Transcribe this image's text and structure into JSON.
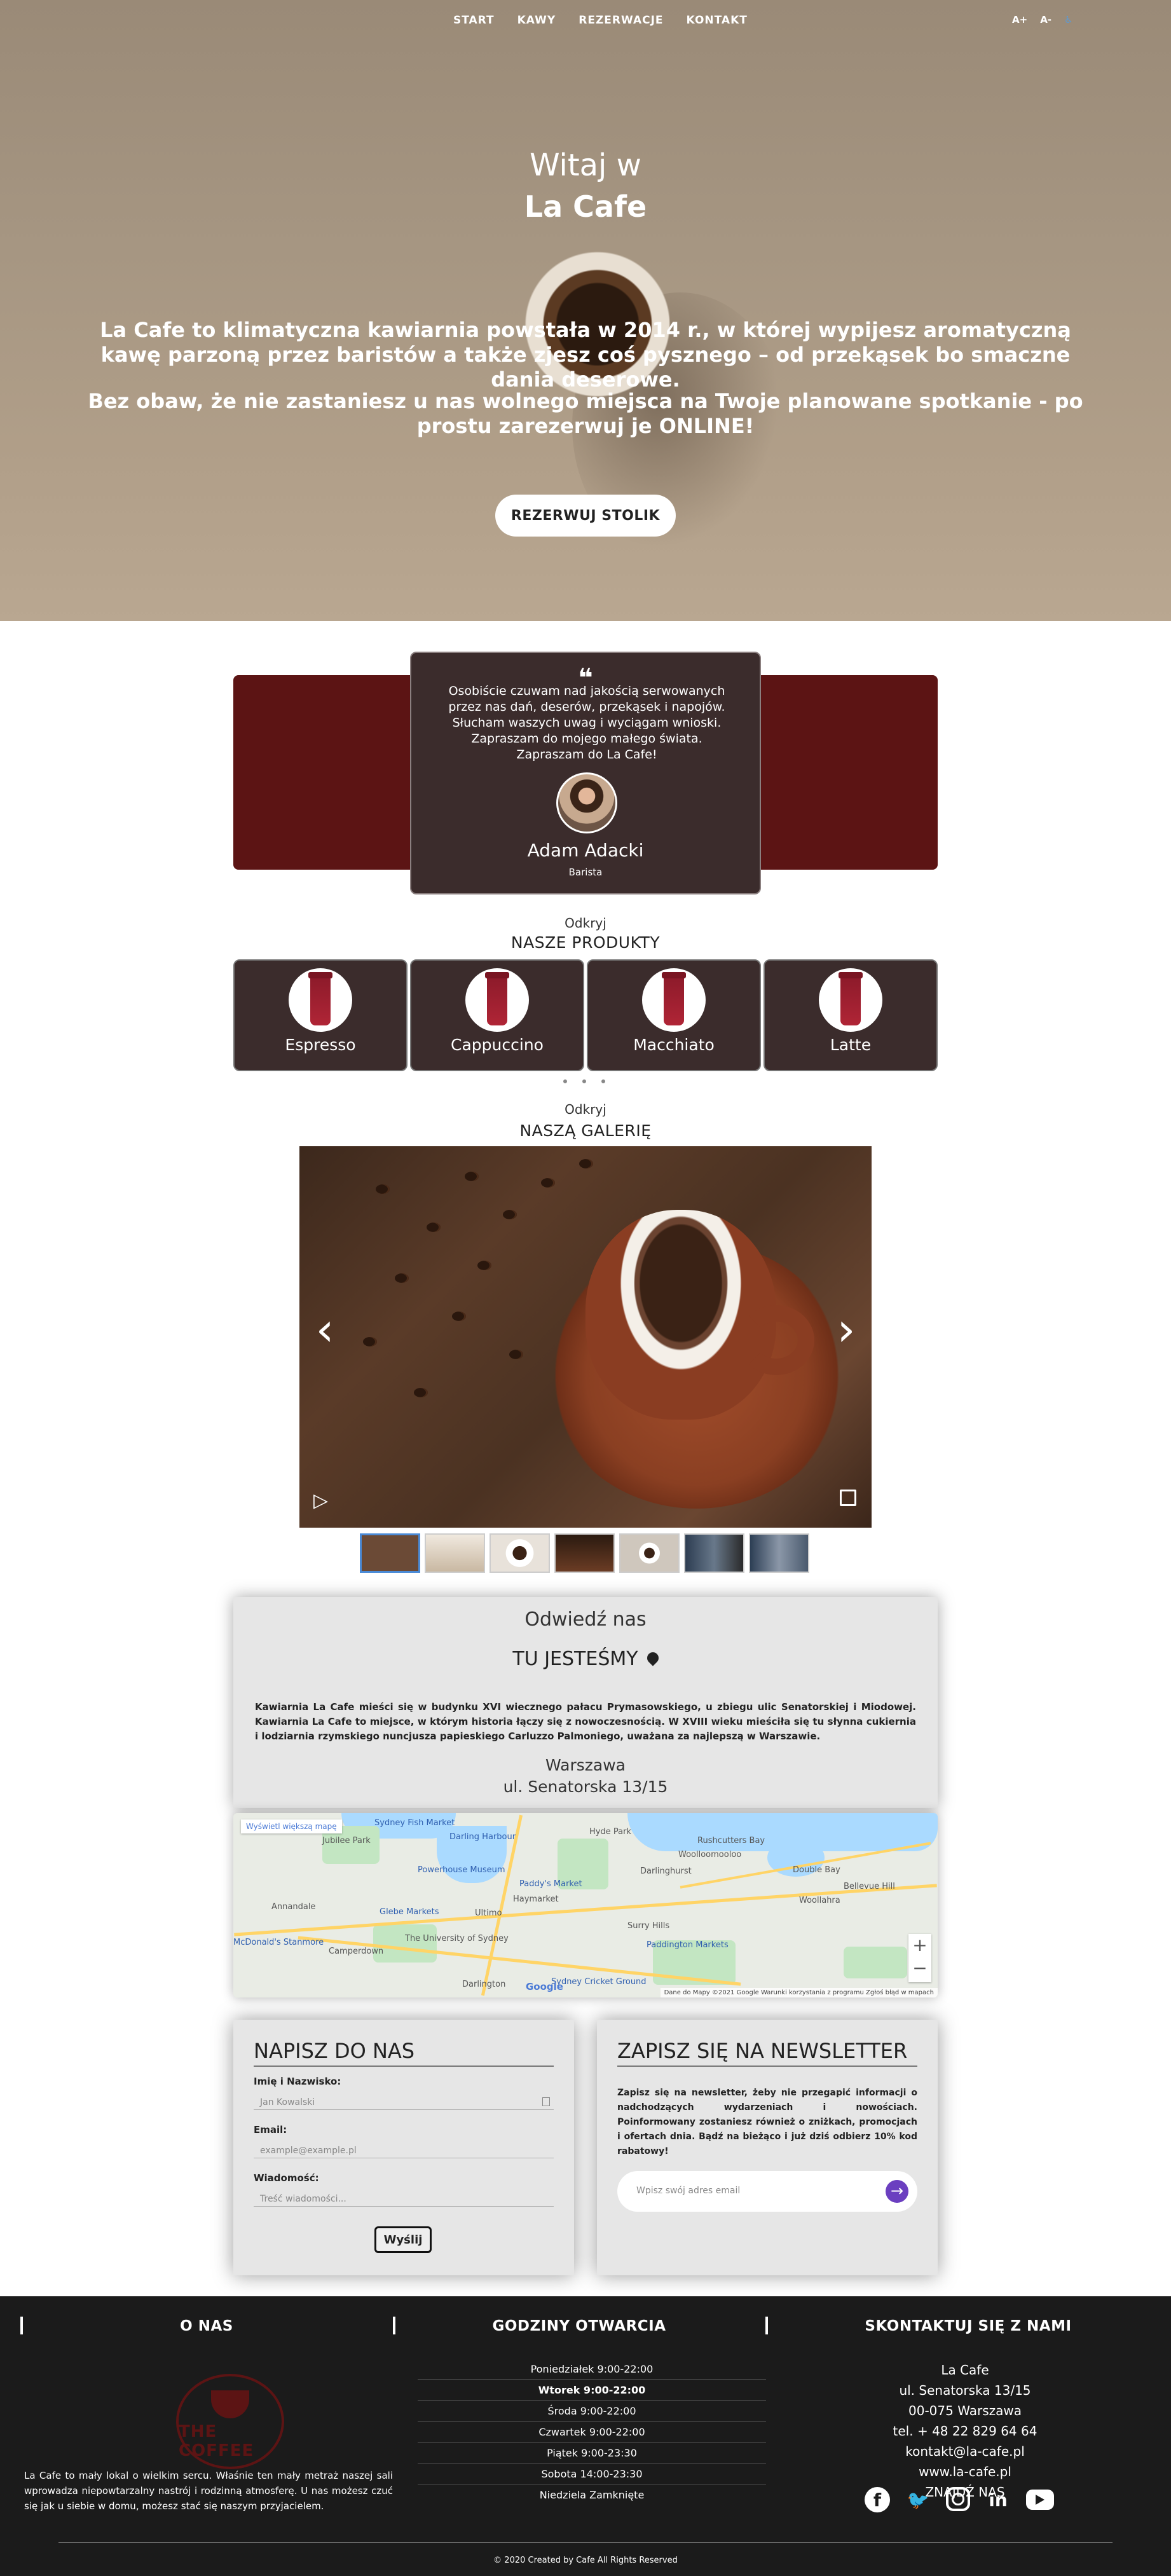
{
  "nav": {
    "links": [
      "START",
      "KAWY",
      "REZERWACJE",
      "KONTAKT"
    ],
    "font_bigger": "A+",
    "font_smaller": "A-"
  },
  "hero": {
    "title_line1": "Witaj w",
    "title_line2": "La Cafe",
    "paragraph1": "La Cafe to klimatyczna kawiarnia powstała w 2014 r., w której wypijesz aromatyczną kawę parzoną przez baristów a także zjesz coś pysznego – od przekąsek bo smaczne dania deserowe.",
    "paragraph2": "Bez obaw, że nie zastaniesz u nas wolnego miejsca na Twoje planowane spotkanie - po prostu zarezerwuj je ONLINE!",
    "cta": "REZERWUJ STOLIK"
  },
  "testimonial": {
    "quote_mark": "❝",
    "text": "Osobiście czuwam nad jakością serwowanych przez nas dań, deserów, przekąsek i napojów. Słucham waszych uwag i wyciągam wnioski. Zapraszam do mojego małego świata. Zapraszam do La Cafe!",
    "name": "Adam Adacki",
    "role": "Barista"
  },
  "products": {
    "subtitle": "Odkryj",
    "title": "NASZE PRODUKTY",
    "items": [
      "Espresso",
      "Cappuccino",
      "Macchiato",
      "Latte"
    ]
  },
  "gallery": {
    "subtitle": "Odkryj",
    "title": "NASZĄ GALERIĘ",
    "prev": "‹",
    "next": "›",
    "play": "▷"
  },
  "visit": {
    "title": "Odwiedź nas",
    "subtitle": "TU JESTEŚMY",
    "description": "Kawiarnia La Cafe mieści się w budynku XVI wiecznego pałacu Prymasowskiego, u zbiegu ulic Senatorskiej i Miodowej. Kawiarnia La Cafe to miejsce, w którym historia łączy się z nowoczesnością. W XVIII wieku mieściła się tu słynna cukiernia i lodziarnia rzymskiego nuncjusza papieskiego Carluzzo Palmoniego, uważana za najlepszą w Warszawie.",
    "city": "Warszawa",
    "street": "ul. Senatorska 13/15"
  },
  "map": {
    "enlarge": "Wyświetl większą mapę",
    "labels": [
      "Sydney Fish Market",
      "Darling Harbour",
      "Hyde Park",
      "Jubilee Park",
      "Powerhouse Museum",
      "Paddy's Market",
      "Haymarket",
      "Glebe Markets",
      "Ultimo",
      "Annandale",
      "McDonald's Stanmore",
      "Camperdown",
      "The University of Sydney",
      "Surry Hills",
      "Paddington Markets",
      "Darlinghurst",
      "Woolloomooloo",
      "Double Bay",
      "Rushcutters Bay",
      "Woollahra",
      "Bellevue Hill",
      "Darlington",
      "Sydney Cricket Ground"
    ],
    "footer": "Dane do Mapy ©2021 Google   Warunki korzystania z programu   Zgłoś błąd w mapach",
    "google": "Google",
    "zoom_in": "+",
    "zoom_out": "−"
  },
  "contact_form": {
    "title": "NAPISZ DO NAS",
    "name_label": "Imię i Nazwisko:",
    "name_placeholder": "Jan Kowalski",
    "email_label": "Email:",
    "email_placeholder": "example@example.pl",
    "message_label": "Wiadomość:",
    "message_placeholder": "Treść wiadomości...",
    "submit": "Wyślij"
  },
  "newsletter": {
    "title": "ZAPISZ SIĘ NA NEWSLETTER",
    "text": "Zapisz się na newsletter, żeby nie przegapić informacji o nadchodzących wydarzeniach i nowościach. Poinformowany zostaniesz również o zniżkach, promocjach i ofertach dnia. Bądź na bieżąco i już dziś odbierz 10% kod rabatowy!",
    "placeholder": "Wpisz swój adres email",
    "submit_icon": "→"
  },
  "footer": {
    "about_title": "O NAS",
    "logo_text": "THE COFFEE",
    "about_text": "La Cafe to mały lokal o wielkim sercu. Właśnie ten mały metraż naszej sali wprowadza niepowtarzalny nastrój i rodzinną atmosferę. U nas możesz czuć się jak u siebie w domu, możesz stać się naszym przyjacielem.",
    "hours_title": "GODZINY OTWARCIA",
    "hours": [
      "Poniedziałek 9:00-22:00",
      "Wtorek 9:00-22:00",
      "Środa 9:00-22:00",
      "Czwartek 9:00-22:00",
      "Piątek 9:00-23:30",
      "Sobota 14:00-23:30",
      "Niedziela Zamknięte"
    ],
    "contact_title": "SKONTAKTUJ SIĘ Z NAMI",
    "contact_lines": [
      "La Cafe",
      "ul. Senatorska 13/15",
      "00-075 Warszawa",
      "tel. + 48 22 829 64 64",
      "kontakt@la-cafe.pl",
      "www.la-cafe.pl",
      "ZNAJDŹ NAS"
    ],
    "social": {
      "facebook": "f",
      "twitter": "🐦",
      "linkedin": "in"
    },
    "copyright": "© 2020 Created by Cafe All Rights Reserved"
  }
}
